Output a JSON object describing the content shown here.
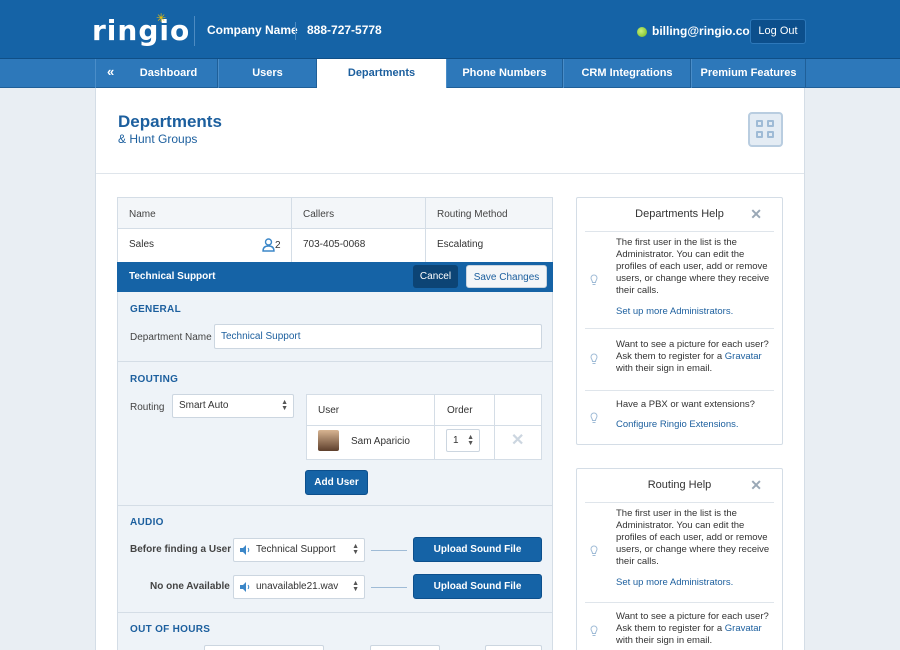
{
  "header": {
    "logo": "ringio",
    "company": "Company Name",
    "phone": "888-727-5778",
    "email": "billing@ringio.com",
    "logout_label": "Log Out"
  },
  "nav": {
    "tabs": [
      {
        "label": "Dashboard"
      },
      {
        "label": "Users"
      },
      {
        "label": "Departments"
      },
      {
        "label": "Phone Numbers"
      },
      {
        "label": "CRM Integrations"
      },
      {
        "label": "Premium Features"
      }
    ],
    "active": "Departments"
  },
  "page": {
    "title": "Departments",
    "subtitle": "& Hunt Groups"
  },
  "dept_table": {
    "headers": [
      "Name",
      "Callers",
      "Routing Method"
    ],
    "rows": [
      {
        "name": "Sales",
        "users": "2",
        "callers": "703-405-0068",
        "routing": "Escalating"
      }
    ]
  },
  "editor": {
    "title": "Technical Support",
    "cancel_label": "Cancel",
    "save_label": "Save Changes",
    "general": {
      "section": "GENERAL",
      "name_label": "Department Name",
      "name_value": "Technical Support"
    },
    "routing": {
      "section": "ROUTING",
      "routing_label": "Routing",
      "routing_value": "Smart Auto",
      "users_headers": [
        "User",
        "Order"
      ],
      "users": [
        {
          "name": "Sam Aparicio",
          "order": "1"
        }
      ],
      "add_user_label": "Add User"
    },
    "audio": {
      "section": "AUDIO",
      "before_label": "Before finding a User",
      "before_value": "Technical Support",
      "none_label": "No one Available",
      "none_value": "unavailable21.wav",
      "upload_label": "Upload Sound File"
    },
    "out_of_hours": {
      "section": "OUT OF HOURS"
    }
  },
  "help_panels": [
    {
      "title": "Departments Help",
      "items": [
        {
          "text": "The first user in the list is the Administrator. You can edit the profiles of each user, add or remove users, or change where they receive their calls.",
          "link": "Set up more Administrators."
        },
        {
          "text": "Want to see a picture for each user? Ask them to register for a",
          "link": "Gravatar",
          "suffix": "with their sign in email."
        },
        {
          "text": "Have a PBX or want extensions?",
          "link": "Configure Ringio Extensions."
        }
      ]
    },
    {
      "title": "Routing Help",
      "items": [
        {
          "text": "The first user in the list is the Administrator. You can edit the profiles of each user, add or remove users, or change where they receive their calls.",
          "link": "Set up more Administrators."
        },
        {
          "text": "Want to see a picture for each user? Ask them to register for a",
          "link": "Gravatar",
          "suffix": "with their sign in email."
        }
      ]
    }
  ],
  "colors": {
    "brand_blue": "#1563a6",
    "nav_blue": "#2d78ba",
    "accent_text": "#1c5f9e",
    "status_green": "#6fb51e"
  }
}
